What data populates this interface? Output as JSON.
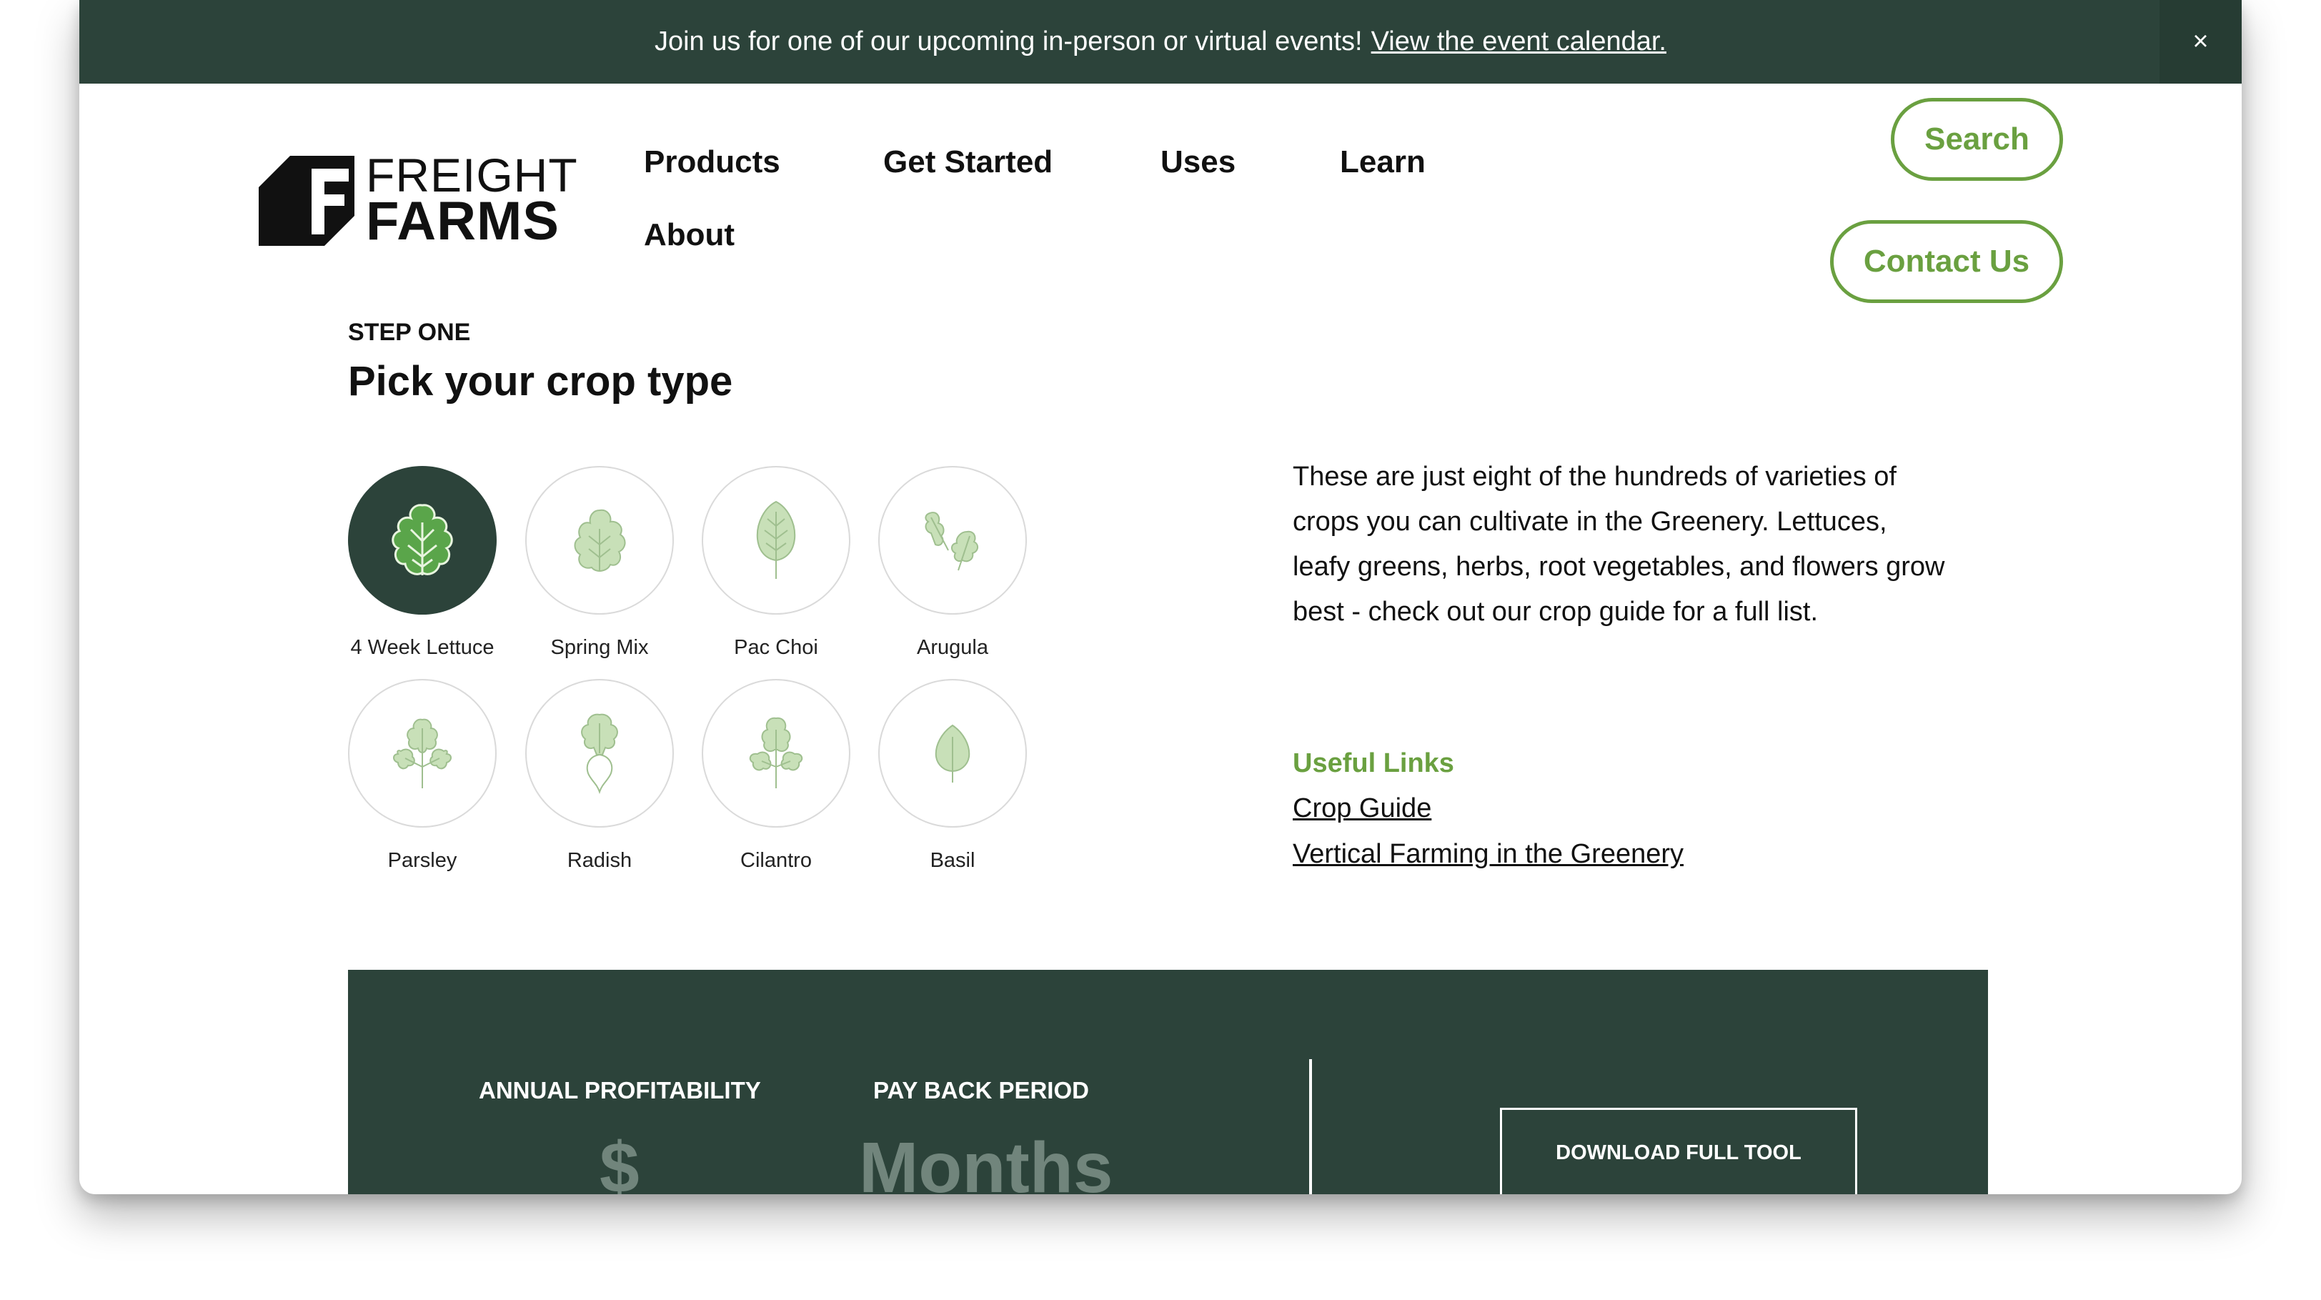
{
  "banner": {
    "text": "Join us for one of our upcoming in-person or virtual events!",
    "link": "View the event calendar.",
    "close": "×"
  },
  "logo": {
    "line1": "FREIGHT",
    "line2": "FARMS"
  },
  "nav": {
    "products": "Products",
    "get_started": "Get Started",
    "uses": "Uses",
    "learn": "Learn",
    "about": "About",
    "search": "Search",
    "contact": "Contact Us"
  },
  "step": {
    "eyebrow": "STEP ONE",
    "title": "Pick your crop type"
  },
  "crops": [
    {
      "label": "4 Week Lettuce",
      "icon": "lettuce-icon",
      "selected": true
    },
    {
      "label": "Spring Mix",
      "icon": "spring-mix-icon",
      "selected": false
    },
    {
      "label": "Pac Choi",
      "icon": "pac-choi-icon",
      "selected": false
    },
    {
      "label": "Arugula",
      "icon": "arugula-icon",
      "selected": false
    },
    {
      "label": "Parsley",
      "icon": "parsley-icon",
      "selected": false
    },
    {
      "label": "Radish",
      "icon": "radish-icon",
      "selected": false
    },
    {
      "label": "Cilantro",
      "icon": "cilantro-icon",
      "selected": false
    },
    {
      "label": "Basil",
      "icon": "basil-icon",
      "selected": false
    }
  ],
  "description": "These are just eight of the hundreds of varieties of crops you can cultivate in the Greenery. Lettuces, leafy greens, herbs, root vegetables, and flowers grow best - check out our crop guide for a full list.",
  "useful_links": {
    "title": "Useful Links",
    "items": [
      "Crop Guide",
      "Vertical Farming in the Greenery"
    ]
  },
  "calculator": {
    "annual_label": "ANNUAL PROFITABILITY",
    "annual_value": "$",
    "payback_label": "PAY BACK PERIOD",
    "payback_value": "Months",
    "download": "DOWNLOAD FULL TOOL"
  },
  "colors": {
    "dark_green": "#2c433a",
    "accent_green": "#6aa040",
    "icon_green": "#c8e0b8"
  }
}
